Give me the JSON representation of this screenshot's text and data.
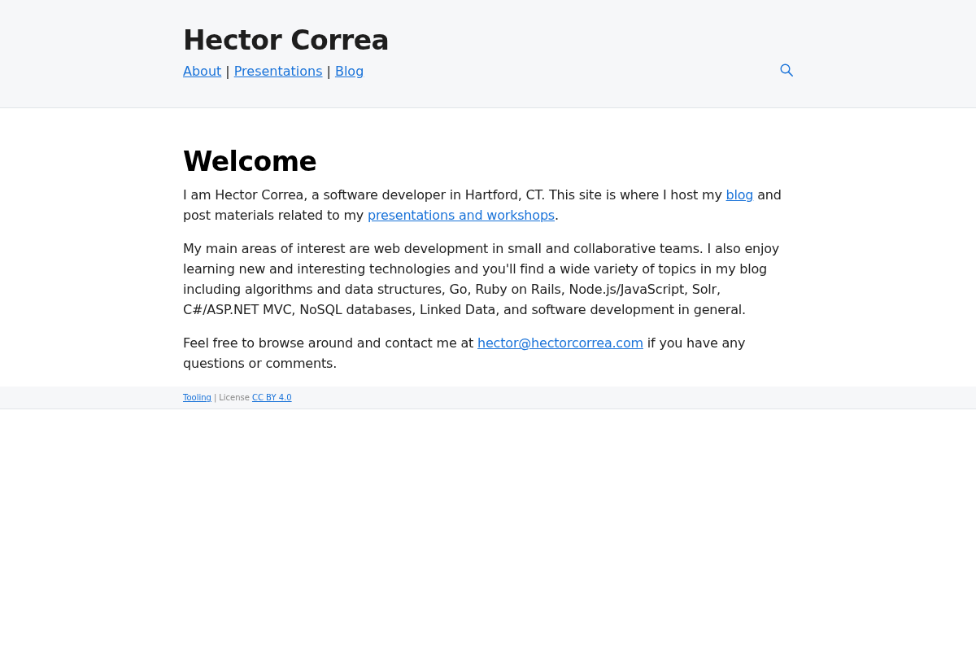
{
  "header": {
    "title": "Hector Correa",
    "nav": [
      {
        "kind": "link",
        "text": "About"
      },
      {
        "kind": "separator",
        "text": "|"
      },
      {
        "kind": "link",
        "text": "Presentations"
      },
      {
        "kind": "separator",
        "text": "|"
      },
      {
        "kind": "link",
        "text": "Blog"
      }
    ]
  },
  "main": {
    "heading": "Welcome",
    "paragraphs": [
      {
        "parts": [
          {
            "kind": "text",
            "text": "I am Hector Correa, a software developer in Hartford, CT. This site is where I host my "
          },
          {
            "kind": "link",
            "text": "blog"
          },
          {
            "kind": "text",
            "text": " and post materials related to my "
          },
          {
            "kind": "link",
            "text": "presentations and workshops"
          },
          {
            "kind": "text",
            "text": "."
          }
        ]
      },
      {
        "parts": [
          {
            "kind": "text",
            "text": "My main areas of interest are web development in small and collaborative teams. I also enjoy learning new and interesting technologies and you'll find a wide variety of topics in my blog including algorithms and data structures, Go, Ruby on Rails, Node.js/JavaScript, Solr, C#/ASP.NET MVC, NoSQL databases, Linked Data, and software development in general."
          }
        ]
      },
      {
        "parts": [
          {
            "kind": "text",
            "text": "Feel free to browse around and contact me at "
          },
          {
            "kind": "link",
            "text": "hector@hectorcorrea.com"
          },
          {
            "kind": "text",
            "text": " if you have any questions or comments."
          }
        ]
      }
    ]
  },
  "footer": {
    "parts": [
      {
        "kind": "link",
        "text": "Tooling"
      },
      {
        "kind": "separator",
        "text": "|"
      },
      {
        "kind": "text",
        "text": "License"
      },
      {
        "kind": "link",
        "text": "CC BY 4.0"
      }
    ]
  }
}
